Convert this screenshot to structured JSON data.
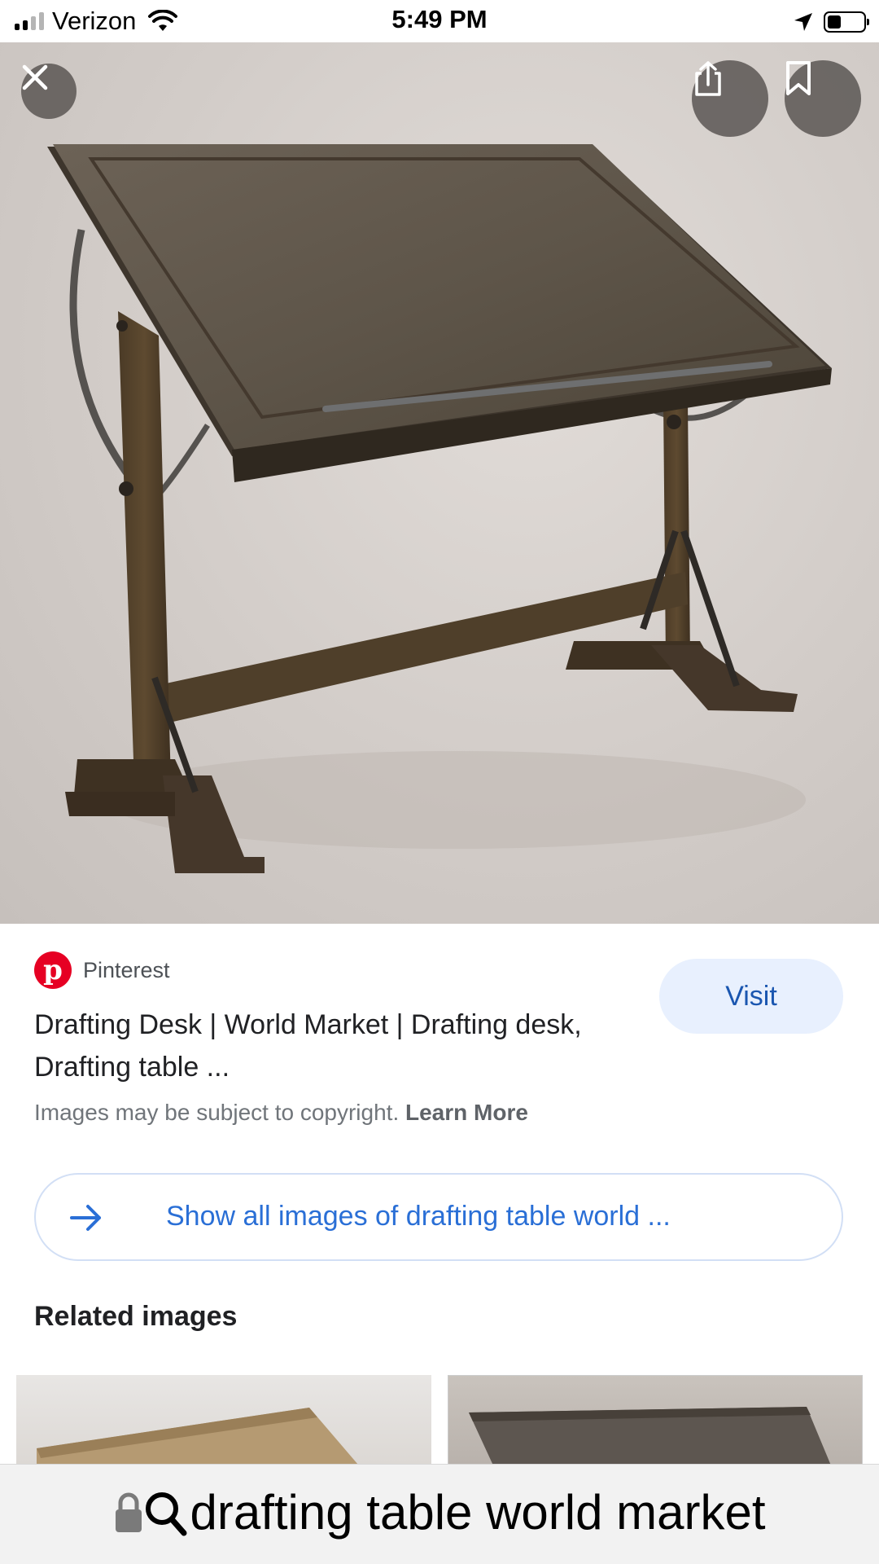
{
  "status_bar": {
    "carrier": "Verizon",
    "time": "5:49 PM",
    "icons": [
      "signal-icon",
      "wifi-icon",
      "location-arrow-icon",
      "battery-icon"
    ]
  },
  "hero": {
    "icons": {
      "close": "close-icon",
      "share": "share-icon",
      "bookmark": "bookmark-icon"
    }
  },
  "result": {
    "source_name": "Pinterest",
    "source_logo_letter": "p",
    "title": "Drafting Desk | World Market | Drafting desk, Drafting table ...",
    "visit_label": "Visit",
    "copyright_text": "Images may be subject to copyright.",
    "learn_more": "Learn More"
  },
  "show_all": {
    "label": "Show all images of drafting table world ...",
    "icon": "arrow-right-icon"
  },
  "related": {
    "title": "Related images"
  },
  "url_bar": {
    "text": "drafting table world market",
    "icons": [
      "lock-icon",
      "search-icon"
    ]
  },
  "colors": {
    "accent_blue": "#2a6fd6",
    "visit_bg": "#e8f0fe",
    "pinterest_red": "#e60023"
  }
}
